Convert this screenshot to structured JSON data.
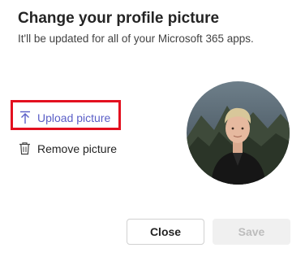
{
  "dialog": {
    "title": "Change your profile picture",
    "subtitle": "It'll be updated for all of your Microsoft 365 apps."
  },
  "actions": {
    "upload_label": "Upload picture",
    "upload_icon": "upload-icon",
    "remove_label": "Remove picture",
    "remove_icon": "trash-icon"
  },
  "buttons": {
    "close_label": "Close",
    "save_label": "Save",
    "save_enabled": false
  },
  "colors": {
    "accent": "#5b5fc7",
    "highlight": "#e3101f",
    "disabled_bg": "#f0f0f0",
    "disabled_text": "#bdbdbd"
  }
}
